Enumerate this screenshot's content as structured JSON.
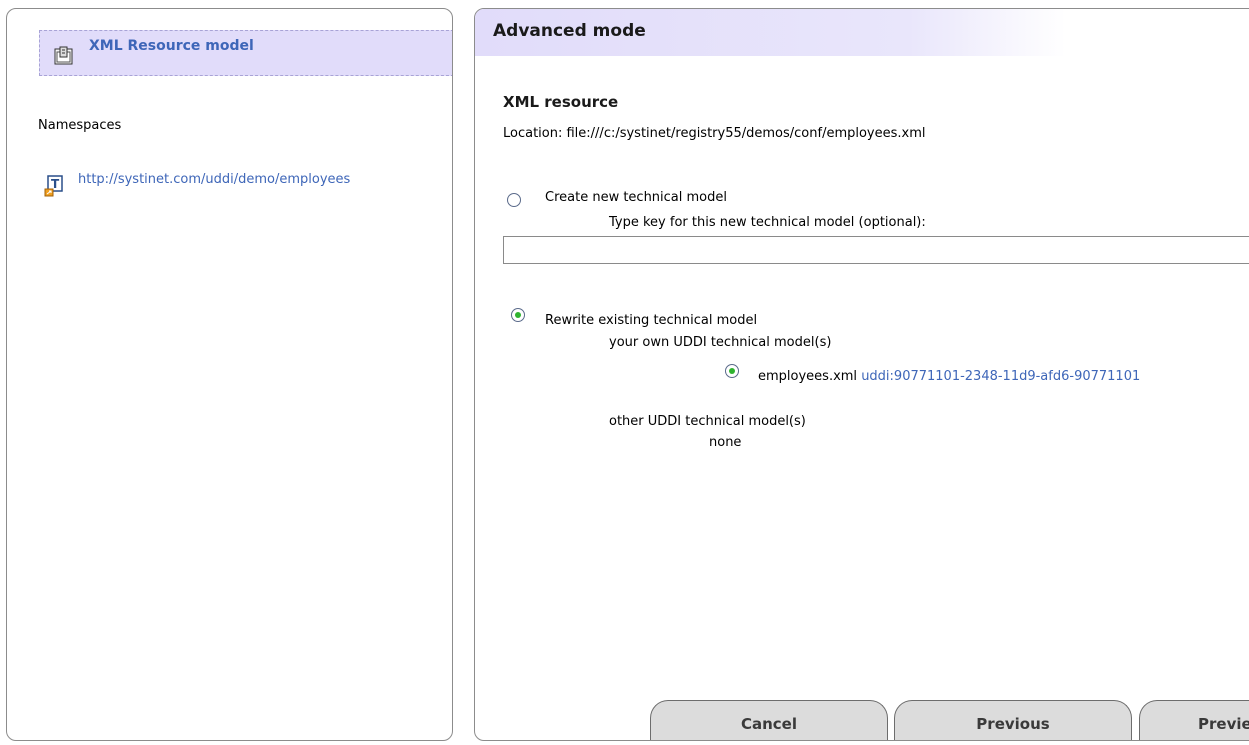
{
  "sidebar": {
    "resource_title": "XML Resource model",
    "namespaces_label": "Namespaces",
    "namespace_link": "http://systinet.com/uddi/demo/employees"
  },
  "main": {
    "header_title": "Advanced mode",
    "section_title": "XML resource",
    "location": "Location: file:///c:/systinet/registry55/demos/conf/employees.xml",
    "create_option": {
      "label": "Create new technical model",
      "hint": "Type key for this new technical model (optional):",
      "value": ""
    },
    "rewrite_option": {
      "label": "Rewrite existing technical model",
      "own_heading": "your own UDDI technical model(s)",
      "own_model_name": "employees.xml",
      "own_model_key": "uddi:90771101-2348-11d9-afd6-90771101",
      "other_heading": "other UDDI technical model(s)",
      "other_value": "none"
    }
  },
  "buttons": {
    "cancel": "Cancel",
    "previous": "Previous",
    "preview": "Preview"
  }
}
